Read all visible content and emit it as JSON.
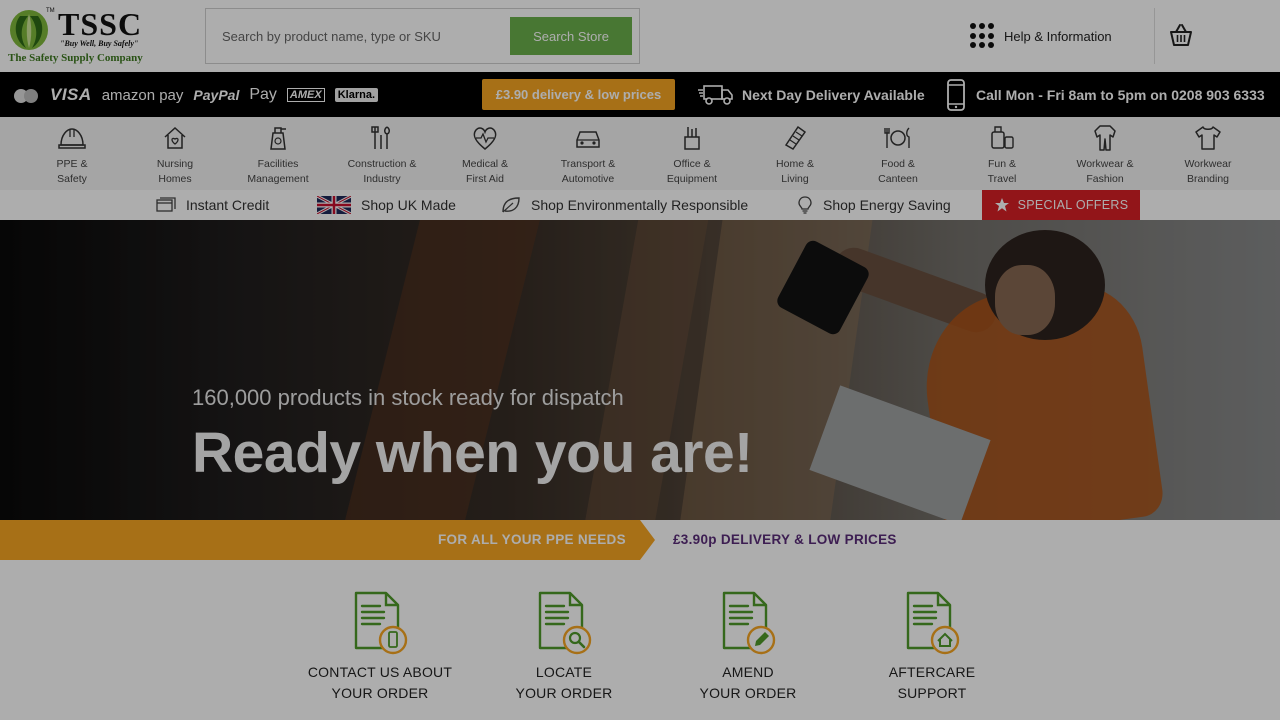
{
  "header": {
    "logo": {
      "brand": "TSSC",
      "tm": "TM",
      "tagline": "\"Buy Well, Buy Safely\"",
      "company": "The Safety Supply Company"
    },
    "search": {
      "placeholder": "Search by product name, type or SKU",
      "button_label": "Search Store"
    },
    "help_label": "Help & Information",
    "basket_icon": "basket-icon"
  },
  "infobar": {
    "payments": [
      "VISA",
      "amazon pay",
      "PayPal",
      "Pay",
      "AMEX",
      "Klarna."
    ],
    "delivery_badge": "£3.90 delivery & low prices",
    "next_day": "Next Day Delivery Available",
    "call": "Call Mon - Fri 8am to 5pm on 0208 903 6333"
  },
  "categories": [
    {
      "l1": "PPE &",
      "l2": "Safety",
      "icon": "hard-hat-icon"
    },
    {
      "l1": "Nursing",
      "l2": "Homes",
      "icon": "care-home-icon"
    },
    {
      "l1": "Facilities",
      "l2": "Management",
      "icon": "spray-bottle-icon"
    },
    {
      "l1": "Construction &",
      "l2": "Industry",
      "icon": "tools-icon"
    },
    {
      "l1": "Medical &",
      "l2": "First Aid",
      "icon": "heartbeat-icon"
    },
    {
      "l1": "Transport &",
      "l2": "Automotive",
      "icon": "car-icon"
    },
    {
      "l1": "Office &",
      "l2": "Equipment",
      "icon": "stationery-icon"
    },
    {
      "l1": "Home &",
      "l2": "Living",
      "icon": "home-living-icon"
    },
    {
      "l1": "Food &",
      "l2": "Canteen",
      "icon": "cutlery-icon"
    },
    {
      "l1": "Fun &",
      "l2": "Travel",
      "icon": "luggage-icon"
    },
    {
      "l1": "Workwear &",
      "l2": "Fashion",
      "icon": "overalls-icon"
    },
    {
      "l1": "Workwear",
      "l2": "Branding",
      "icon": "tshirt-icon"
    }
  ],
  "secondary": {
    "instant_credit": "Instant Credit",
    "uk_made": "Shop UK Made",
    "eco": "Shop Environmentally Responsible",
    "energy": "Shop Energy Saving",
    "special": "SPECIAL OFFERS"
  },
  "hero": {
    "subtitle": "160,000 products in stock ready for dispatch",
    "title": "Ready when you are!"
  },
  "promo": {
    "left": "FOR ALL YOUR PPE NEEDS",
    "right": "£3.90p DELIVERY & LOW PRICES"
  },
  "services": [
    {
      "l1": "CONTACT US ABOUT",
      "l2": "YOUR ORDER",
      "icon": "document-phone-icon"
    },
    {
      "l1": "LOCATE",
      "l2": "YOUR ORDER",
      "icon": "document-search-icon"
    },
    {
      "l1": "AMEND",
      "l2": "YOUR ORDER",
      "icon": "document-edit-icon"
    },
    {
      "l1": "AFTERCARE",
      "l2": "SUPPORT",
      "icon": "document-home-icon"
    }
  ],
  "colors": {
    "green": "#6ab04c",
    "orange": "#f6a623",
    "red": "#d71f26",
    "purple": "#5b2d7a",
    "logo_green": "#3d7a1f"
  }
}
